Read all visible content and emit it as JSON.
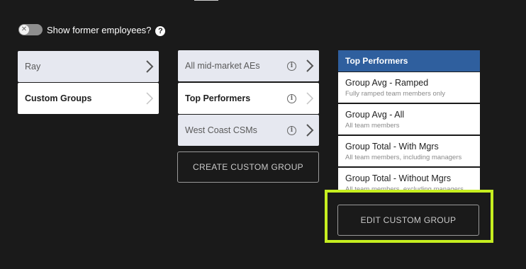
{
  "toggle": {
    "knob_symbol": "✕",
    "label": "Show former employees?",
    "help_symbol": "?"
  },
  "left_column": [
    {
      "label": "Ray",
      "active": false
    },
    {
      "label": "Custom Groups",
      "active": true
    }
  ],
  "middle_column": [
    {
      "label": "All mid-market AEs",
      "active": false
    },
    {
      "label": "Top Performers",
      "active": true
    },
    {
      "label": "West Coast CSMs",
      "active": false
    }
  ],
  "info_symbol": "i",
  "create_button": "CREATE CUSTOM GROUP",
  "right_column": {
    "header": "Top Performers",
    "options": [
      {
        "title": "Group Avg - Ramped",
        "subtitle": "Fully ramped team members only"
      },
      {
        "title": "Group Avg - All",
        "subtitle": "All team members"
      },
      {
        "title": "Group Total - With Mgrs",
        "subtitle": "All team members, including managers"
      },
      {
        "title": "Group Total - Without Mgrs",
        "subtitle": "All team members, excluding managers"
      }
    ]
  },
  "edit_button": "EDIT CUSTOM GROUP",
  "colors": {
    "background": "#1a1a1a",
    "header_blue": "#2f5f9e",
    "highlight": "#c6ee20",
    "card": "#e6e8f0"
  }
}
